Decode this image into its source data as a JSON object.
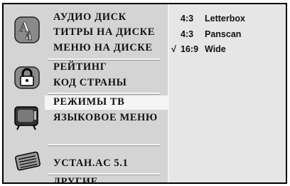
{
  "menu": {
    "group1": [
      "АУДИО ДИСК",
      "ТИТРЫ НА ДИСКЕ",
      "МЕНЮ НА ДИСКЕ"
    ],
    "group2": [
      "РЕЙТИНГ",
      "КОД СТРАНЫ"
    ],
    "group3": [
      "РЕЖИМЫ ТВ",
      "ЯЗЫКОВОЕ МЕНЮ"
    ],
    "group4": [
      "УСТАН.AC 5.1"
    ],
    "group5": [
      "ДРУГИЕ"
    ],
    "selected": "РЕЖИМЫ ТВ",
    "icons": [
      "language-icon",
      "lock-icon",
      "tv-icon",
      "speaker-icon"
    ]
  },
  "options": [
    {
      "check": "",
      "ratio": "4:3",
      "label": "Letterbox"
    },
    {
      "check": "✓",
      "ratio": "4:3",
      "label": "Panscan"
    },
    {
      "check": "√",
      "ratio": "16:9",
      "label": "Wide"
    }
  ],
  "colors": {
    "panel": "#d4d4d4",
    "highlight": "#f5f5f5",
    "options_bg": "#e6e6e6"
  }
}
